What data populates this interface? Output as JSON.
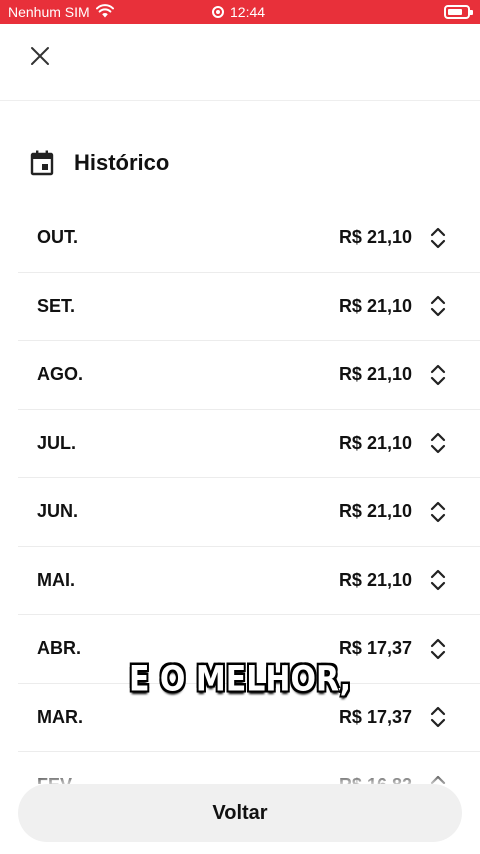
{
  "status_bar": {
    "carrier": "Nenhum SIM",
    "time": "12:44",
    "background": "#e8303a"
  },
  "header": {
    "close_icon": "close-icon"
  },
  "section": {
    "icon": "calendar-icon",
    "title": "Histórico"
  },
  "history": {
    "items": [
      {
        "month": "OUT.",
        "amount": "R$ 21,10"
      },
      {
        "month": "SET.",
        "amount": "R$ 21,10"
      },
      {
        "month": "AGO.",
        "amount": "R$ 21,10"
      },
      {
        "month": "JUL.",
        "amount": "R$ 21,10"
      },
      {
        "month": "JUN.",
        "amount": "R$ 21,10"
      },
      {
        "month": "MAI.",
        "amount": "R$ 21,10"
      },
      {
        "month": "ABR.",
        "amount": "R$ 17,37"
      },
      {
        "month": "MAR.",
        "amount": "R$ 17,37"
      },
      {
        "month": "FEV.",
        "amount": "R$ 16,82"
      }
    ],
    "row_icon": "chevron-up-down-icon"
  },
  "caption": "E O MELHOR,",
  "footer": {
    "back_label": "Voltar"
  }
}
